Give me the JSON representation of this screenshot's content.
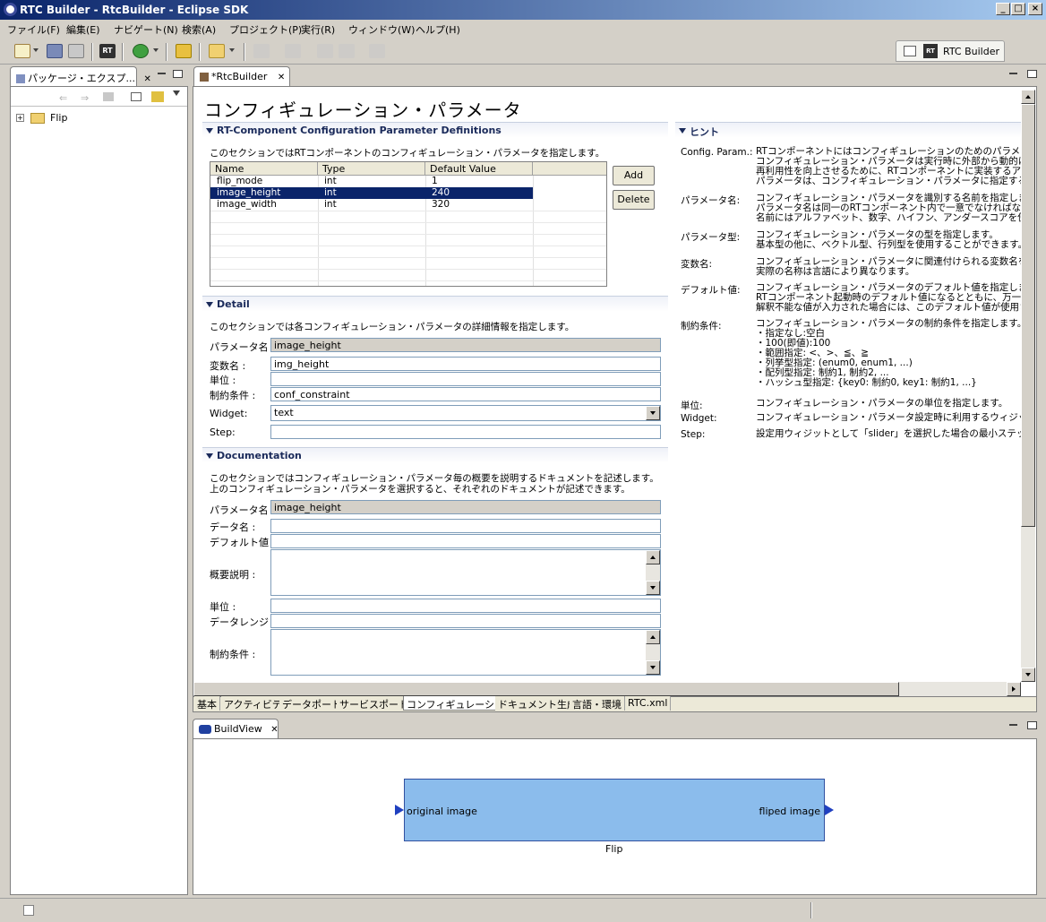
{
  "window": {
    "title": "RTC Builder - RtcBuilder - Eclipse SDK",
    "controls": [
      "_",
      "□",
      "×"
    ]
  },
  "menu": [
    "ファイル(F)",
    "編集(E)",
    "ナビゲート(N)",
    "検索(A)",
    "プロジェクト(P)",
    "実行(R)",
    "ウィンドウ(W)",
    "ヘルプ(H)"
  ],
  "perspective": {
    "label": "RTC Builder"
  },
  "package_explorer": {
    "tab_label": "パッケージ・エクスプ...",
    "tree": [
      {
        "label": "Flip",
        "expander": "+"
      }
    ]
  },
  "editor": {
    "tab_label": "*RtcBuilder",
    "page_title": "コンフィギュレーション・パラメータ",
    "sections": {
      "definitions": {
        "title": "RT-Component Configuration Parameter Definitions",
        "description": "このセクションではRTコンポーネントのコンフィギュレーション・パラメータを指定します。",
        "columns": [
          "Name",
          "Type",
          "Default Value"
        ],
        "rows": [
          {
            "name": "flip_mode",
            "type": "int",
            "default": "1"
          },
          {
            "name": "image_height",
            "type": "int",
            "default": "240"
          },
          {
            "name": "image_width",
            "type": "int",
            "default": "320"
          }
        ],
        "add_label": "Add",
        "delete_label": "Delete"
      },
      "detail": {
        "title": "Detail",
        "description": "このセクションでは各コンフィギュレーション・パラメータの詳細情報を指定します。",
        "fields": {
          "param_name": {
            "label": "パラメータ名 :",
            "value": "image_height"
          },
          "var_name": {
            "label": "変数名 :",
            "value": "img_height"
          },
          "unit": {
            "label": "単位 :",
            "value": ""
          },
          "constraint": {
            "label": "制約条件 :",
            "value": "conf_constraint"
          },
          "widget": {
            "label": "Widget:",
            "value": "text"
          },
          "step": {
            "label": "Step:",
            "value": ""
          }
        }
      },
      "documentation": {
        "title": "Documentation",
        "description_1": "このセクションではコンフィギュレーション・パラメータ毎の概要を説明するドキュメントを記述します。",
        "description_2": "上のコンフィギュレーション・パラメータを選択すると、それぞれのドキュメントが記述できます。",
        "fields": {
          "param_name": {
            "label": "パラメータ名 :",
            "value": "image_height"
          },
          "data_name": {
            "label": "データ名 :",
            "value": ""
          },
          "default": {
            "label": "デフォルト値 :",
            "value": ""
          },
          "overview": {
            "label": "概要説明 :",
            "value": ""
          },
          "unit": {
            "label": "単位 :",
            "value": ""
          },
          "range": {
            "label": "データレンジ :",
            "value": ""
          },
          "constraint": {
            "label": "制約条件 :",
            "value": ""
          }
        }
      },
      "hint": {
        "title": "ヒント",
        "items": [
          {
            "key": "Config. Param.:",
            "lines": [
              "RTコンポーネントにはコンフィギュレーションのためのパラメータを持",
              "コンフィギュレーション・パラメータは実行時に外部から動的に変更",
              "再利用性を向上させるために、RTコンポーネントに実装するアル",
              "パラメータは、コンフィギュレーション・パラメータに指定することを推"
            ]
          },
          {
            "key": "パラメータ名:",
            "lines": [
              "コンフィギュレーション・パラメータを識別する名前を指定します。",
              "パラメータ名は同一のRTコンポーネント内で一意でなければなり",
              "名前にはアルファベット、数字、ハイフン、アンダースコアを使用す"
            ]
          },
          {
            "key": "パラメータ型:",
            "lines": [
              "コンフィギュレーション・パラメータの型を指定します。",
              "基本型の他に、ベクトル型、行列型を使用することができます。"
            ]
          },
          {
            "key": "変数名:",
            "lines": [
              "コンフィギュレーション・パラメータに関連付けられる変数名を指定",
              "実際の名称は言語により異なります。"
            ]
          },
          {
            "key": "デフォルト値:",
            "lines": [
              "コンフィギュレーション・パラメータのデフォルト値を指定します。",
              "RTコンポーネント起動時のデフォルト値になるとともに、万一外部",
              "解釈不能な値が入力された場合には、このデフォルト値が使用さ"
            ]
          },
          {
            "key": "制約条件:",
            "lines": [
              "コンフィギュレーション・パラメータの制約条件を指定します。",
              "・指定なし:空白",
              "・100(即値):100",
              "・範囲指定: <、>、≦、≧",
              "・列挙型指定: (enum0, enum1, ...)",
              "・配列型指定: 制約1, 制約2, ...",
              "・ハッシュ型指定: {key0: 制約0, key1: 制約1, ...}"
            ]
          },
          {
            "key": "単位:",
            "lines": [
              "コンフィギュレーション・パラメータの単位を指定します。"
            ]
          },
          {
            "key": "Widget:",
            "lines": [
              "コンフィギュレーション・パラメータ設定時に利用するウィジットを指"
            ]
          },
          {
            "key": "Step:",
            "lines": [
              "設定用ウィジットとして「slider」を選択した場合の最小ステップを"
            ]
          }
        ]
      }
    },
    "bottom_tabs": [
      "基本",
      "アクティビティ",
      "データポート",
      "サービスポート",
      "コンフィギュレーション",
      "ドキュメント生成",
      "言語・環境",
      "RTC.xml"
    ],
    "active_bottom_tab": 4
  },
  "build_view": {
    "tab_label": "BuildView",
    "component": {
      "name": "Flip",
      "in_port": "original image",
      "out_port": "fliped image",
      "fill": "#8bbcec"
    }
  },
  "colors": {
    "selection": "#0a246a",
    "title_gradient_start": "#0a246a",
    "title_gradient_end": "#a6caf0"
  }
}
